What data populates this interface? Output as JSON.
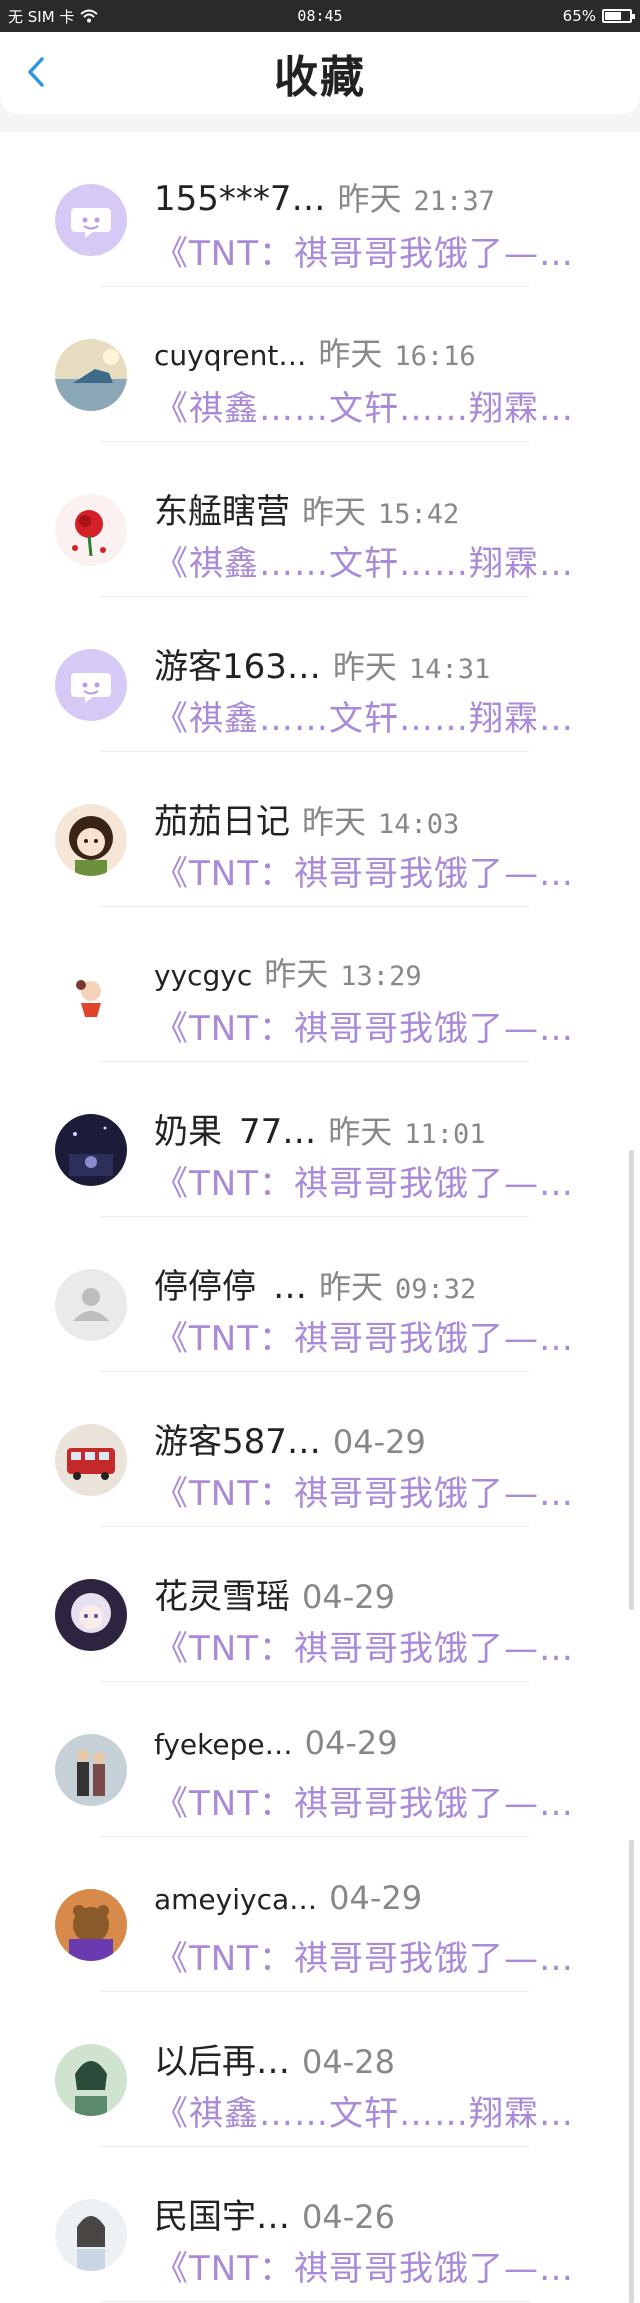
{
  "status_bar": {
    "left_text": "无 SIM 卡",
    "time": "08:45",
    "battery": "65%",
    "battery_level": 0.65
  },
  "header": {
    "title": "收藏"
  },
  "items": [
    {
      "name": "155***7…",
      "date": "昨天",
      "time": "21:37",
      "message": "《TNT：祺哥哥我饿了—…",
      "avatar": "chat-bubble"
    },
    {
      "name": "cuyqrent…",
      "date": "昨天",
      "time": "16:16",
      "message": "《祺鑫……文轩……翔霖…",
      "avatar": "photo-shoe"
    },
    {
      "name": "东艋瞎营",
      "date": "昨天",
      "time": "15:42",
      "message": "《祺鑫……文轩……翔霖…",
      "avatar": "photo-rose"
    },
    {
      "name": "游客163…",
      "date": "昨天",
      "time": "14:31",
      "message": "《祺鑫……文轩……翔霖…",
      "avatar": "chat-bubble"
    },
    {
      "name": "茄茄日记",
      "date": "昨天",
      "time": "14:03",
      "message": "《TNT：祺哥哥我饿了—…",
      "avatar": "photo-girl"
    },
    {
      "name": "yycgyc",
      "date": "昨天",
      "time": "13:29",
      "message": "《TNT：祺哥哥我饿了—…",
      "avatar": "photo-cartoon"
    },
    {
      "name": "奶果_77…",
      "date": "昨天",
      "time": "11:01",
      "message": "《TNT：祺哥哥我饿了—…",
      "avatar": "photo-night"
    },
    {
      "name": "停停停_…",
      "date": "昨天",
      "time": "09:32",
      "message": "《TNT：祺哥哥我饿了—…",
      "avatar": "default-user"
    },
    {
      "name": "游客587…",
      "date": "04-29",
      "time": "",
      "message": "《TNT：祺哥哥我饿了—…",
      "avatar": "photo-bus"
    },
    {
      "name": "花灵雪瑶",
      "date": "04-29",
      "time": "",
      "message": "《TNT：祺哥哥我饿了—…",
      "avatar": "photo-anime"
    },
    {
      "name": "fyekepe…",
      "date": "04-29",
      "time": "",
      "message": "《TNT：祺哥哥我饿了—…",
      "avatar": "photo-couple"
    },
    {
      "name": "ameyiyca…",
      "date": "04-29",
      "time": "",
      "message": "《TNT：祺哥哥我饿了—…",
      "avatar": "photo-bear"
    },
    {
      "name": "以后再…",
      "date": "04-28",
      "time": "",
      "message": "《祺鑫……文轩……翔霖…",
      "avatar": "photo-green"
    },
    {
      "name": "民国宇…",
      "date": "04-26",
      "time": "",
      "message": "《TNT：祺哥哥我饿了—…",
      "avatar": "photo-lady"
    }
  ]
}
